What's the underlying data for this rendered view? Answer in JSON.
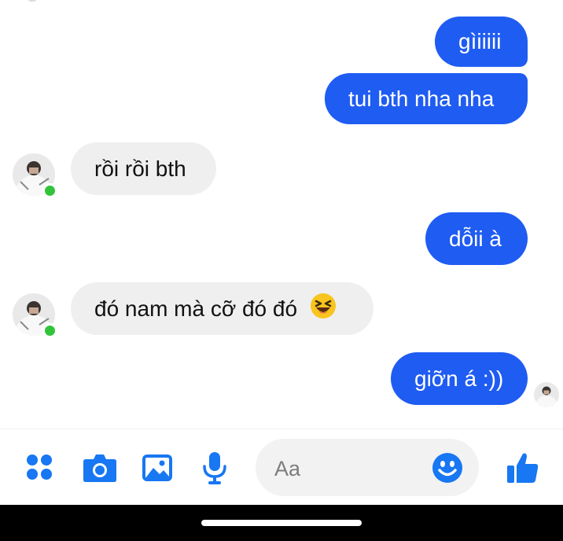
{
  "messages": {
    "m1": "gìiiiii",
    "m2": "tui bth nha nha",
    "m3": "rồi rồi bth",
    "m4": "dỗii à",
    "m5": "đó nam mà cỡ đó đó",
    "m5_emoji": "😆",
    "m6": "giỡn á :))"
  },
  "composer": {
    "placeholder": "Aa",
    "icons": [
      "apps-icon",
      "camera-icon",
      "image-icon",
      "microphone-icon",
      "emoji-icon",
      "like-icon"
    ]
  },
  "colors": {
    "outgoing_bubble": "#1f5cf2",
    "incoming_bubble": "#efefef",
    "accent": "#1877f2",
    "online": "#31c43b"
  }
}
